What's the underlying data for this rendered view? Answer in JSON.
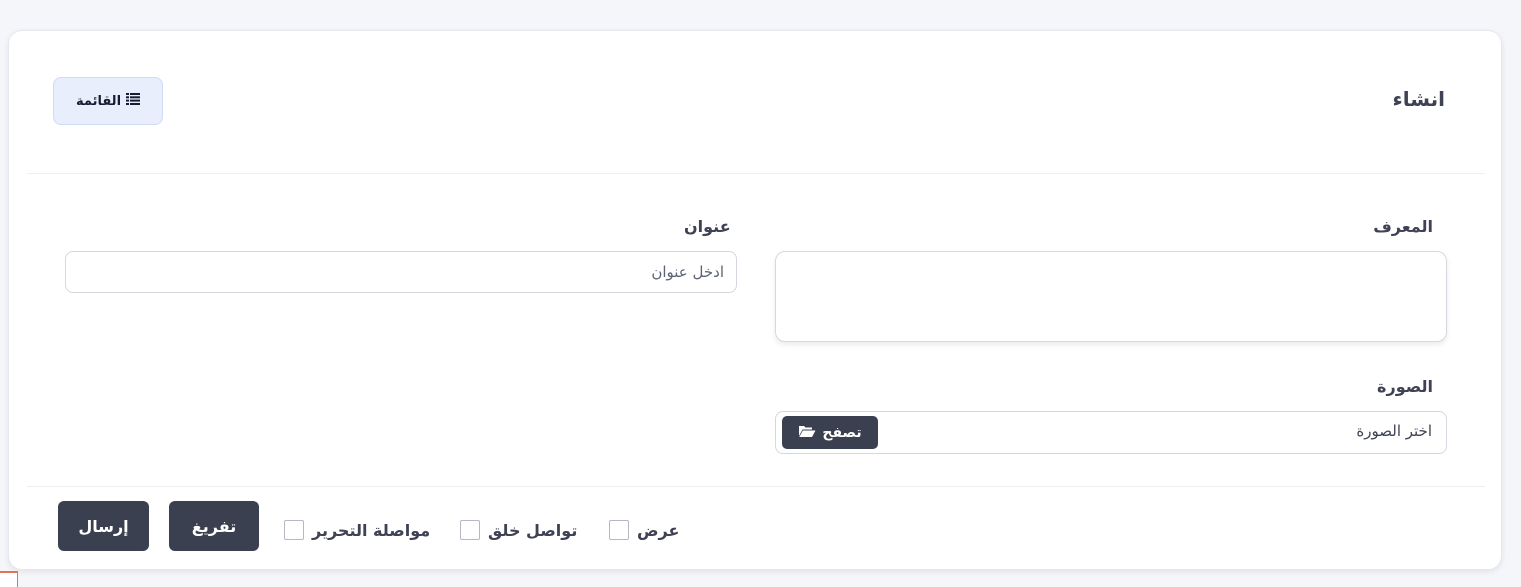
{
  "header": {
    "title": "انشاء",
    "list_button_label": "القائمة",
    "list_icon": "list-icon"
  },
  "form": {
    "identifier": {
      "label": "المعرف",
      "value": ""
    },
    "title": {
      "label": "عنوان",
      "placeholder": "ادخل عنوان",
      "value": ""
    },
    "image": {
      "label": "الصورة",
      "placeholder": "اختر الصورة",
      "browse_label": "تصفح",
      "browse_icon": "folder-open-icon"
    }
  },
  "footer": {
    "checkboxes": [
      {
        "label": "عرض",
        "checked": false
      },
      {
        "label": "تواصل خلق",
        "checked": false
      },
      {
        "label": "مواصلة التحرير",
        "checked": false
      }
    ],
    "clear_label": "تفريغ",
    "submit_label": "إرسال"
  },
  "colors": {
    "accent_dark": "#3a4050",
    "list_button_bg": "#e8eefc",
    "page_bg": "#f5f6fa"
  }
}
